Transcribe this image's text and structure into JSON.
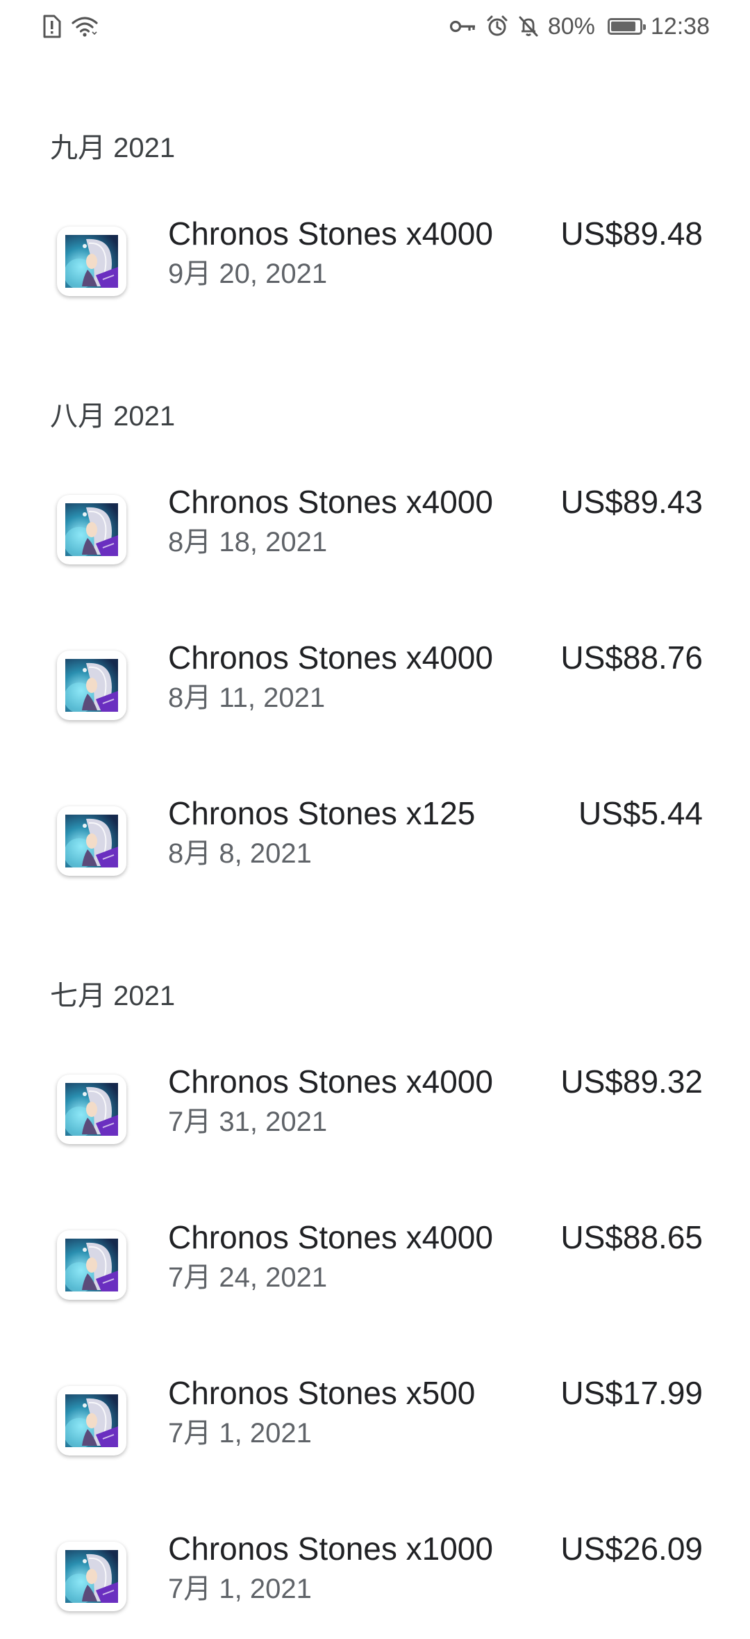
{
  "status_bar": {
    "battery_percent_text": "80%",
    "battery_level": 0.8,
    "time": "12:38",
    "icons": [
      "sim-alert-icon",
      "wifi-icon",
      "vpn-key-icon",
      "alarm-icon",
      "notifications-off-icon",
      "battery-icon"
    ]
  },
  "sections": [
    {
      "header": "九月 2021",
      "items": [
        {
          "title": "Chronos Stones x4000",
          "date": "9月 20, 2021",
          "price": "US$89.48"
        }
      ]
    },
    {
      "header": "八月 2021",
      "items": [
        {
          "title": "Chronos Stones x4000",
          "date": "8月 18, 2021",
          "price": "US$89.43"
        },
        {
          "title": "Chronos Stones x4000",
          "date": "8月 11, 2021",
          "price": "US$88.76"
        },
        {
          "title": "Chronos Stones x125",
          "date": "8月 8, 2021",
          "price": "US$5.44"
        }
      ]
    },
    {
      "header": "七月 2021",
      "items": [
        {
          "title": "Chronos Stones x4000",
          "date": "7月 31, 2021",
          "price": "US$89.32"
        },
        {
          "title": "Chronos Stones x4000",
          "date": "7月 24, 2021",
          "price": "US$88.65"
        },
        {
          "title": "Chronos Stones x500",
          "date": "7月 1, 2021",
          "price": "US$17.99"
        },
        {
          "title": "Chronos Stones x1000",
          "date": "7月 1, 2021",
          "price": "US$26.09"
        }
      ]
    }
  ],
  "colors": {
    "background": "#ffffff",
    "title_text": "#202124",
    "secondary_text": "#5f6368",
    "status_icons": "#555555"
  }
}
